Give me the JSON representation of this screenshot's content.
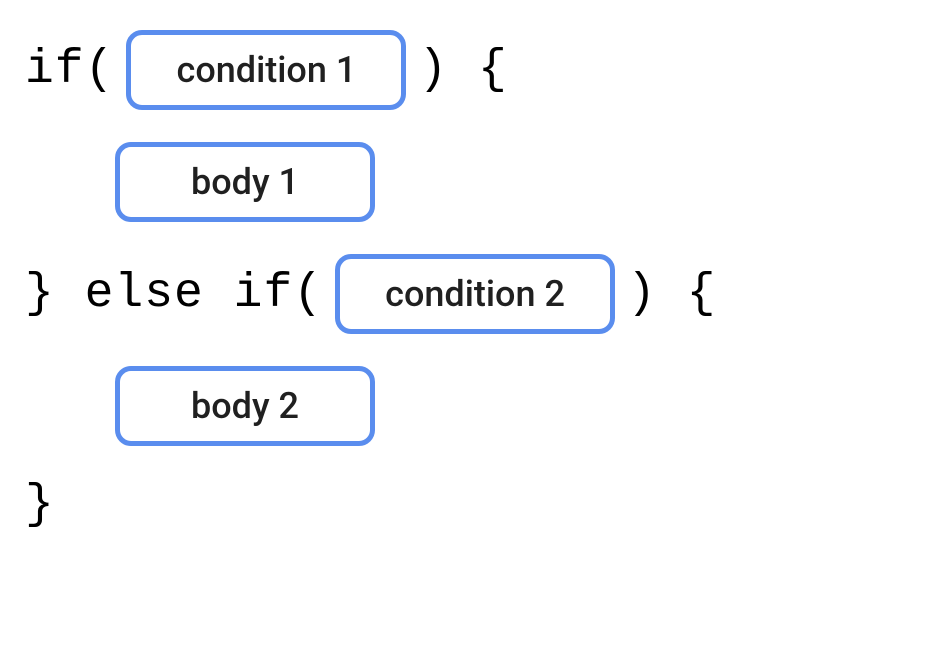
{
  "syntax": {
    "if_open": "if(",
    "paren_close_brace_open": ") {",
    "brace_close_else_if_open": "} else if(",
    "brace_close": "}"
  },
  "placeholders": {
    "condition1": "condition 1",
    "body1": "body 1",
    "condition2": "condition 2",
    "body2": "body 2"
  },
  "colors": {
    "box_border": "#5a8dee",
    "text": "#202020",
    "mono_text": "#000000",
    "background": "#ffffff"
  }
}
